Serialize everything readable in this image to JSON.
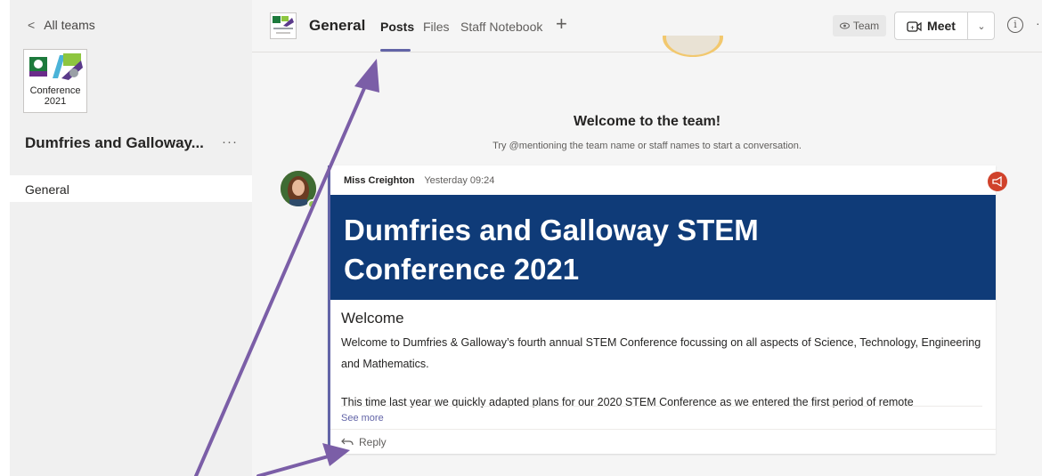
{
  "left_panel": {
    "back_label": "All teams",
    "team_logo": {
      "line1": "Conference",
      "line2": "2021"
    },
    "team_name": "Dumfries and Galloway...",
    "more_label": "···",
    "channels": [
      {
        "label": "General"
      }
    ]
  },
  "header": {
    "channel_name": "General",
    "tabs": [
      {
        "label": "Posts"
      },
      {
        "label": "Files"
      },
      {
        "label": "Staff Notebook"
      }
    ],
    "add_tab": "+",
    "team_label": "Team",
    "meet_label": "Meet",
    "info_label": "i"
  },
  "conversation": {
    "welcome_title": "Welcome to the team!",
    "welcome_sub": "Try @mentioning the team name or staff names to start a conversation.",
    "post": {
      "author": "Miss Creighton",
      "timestamp": "Yesterday 09:24",
      "banner_line1": "Dumfries and Galloway STEM",
      "banner_line2": "Conference 2021",
      "title": "Welcome",
      "paragraph1": "Welcome to Dumfries & Galloway’s fourth annual STEM Conference focussing on all aspects of Science, Technology, Engineering and Mathematics.",
      "paragraph2": "This time last year we quickly adapted plans for our 2020 STEM Conference as we entered the first period of remote",
      "see_more": "See more",
      "reply": "Reply"
    }
  },
  "colors": {
    "accent": "#6264a7",
    "banner": "#0f3b78",
    "announcement": "#d0422b",
    "arrow": "#7b5ea7"
  }
}
